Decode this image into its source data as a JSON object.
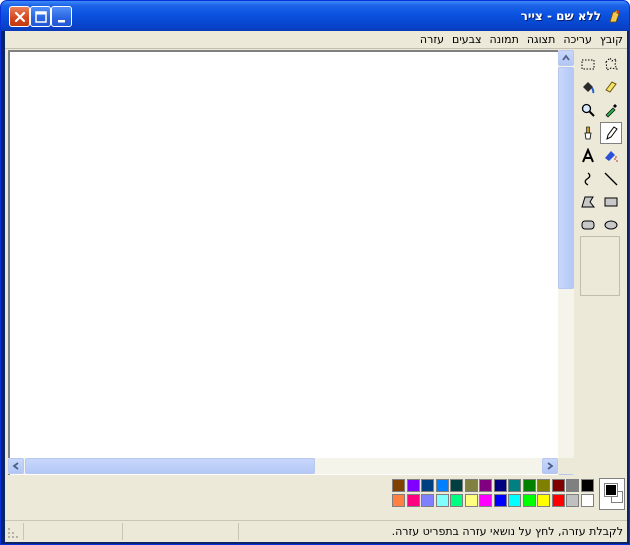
{
  "window": {
    "title": "ללא שם - צייר"
  },
  "menu": [
    "קובץ",
    "עריכה",
    "תצוגה",
    "תמונה",
    "צבעים",
    "עזרה"
  ],
  "tools": [
    "free-form-select-icon",
    "select-icon",
    "eraser-icon",
    "fill-icon",
    "color-picker-icon",
    "magnifier-icon",
    "pencil-icon",
    "brush-icon",
    "airbrush-icon",
    "text-icon",
    "line-icon",
    "curve-icon",
    "rectangle-icon",
    "polygon-icon",
    "ellipse-icon",
    "rounded-rectangle-icon"
  ],
  "selected_tool": "pencil-icon",
  "colors": {
    "foreground": "#000000",
    "background": "#ffffff",
    "palette_top": [
      "#000000",
      "#808080",
      "#800000",
      "#808000",
      "#008000",
      "#008080",
      "#000080",
      "#800080",
      "#808040",
      "#004040",
      "#0080ff",
      "#004080",
      "#8000ff",
      "#804000"
    ],
    "palette_bottom": [
      "#ffffff",
      "#c0c0c0",
      "#ff0000",
      "#ffff00",
      "#00ff00",
      "#00ffff",
      "#0000ff",
      "#ff00ff",
      "#ffff80",
      "#00ff80",
      "#80ffff",
      "#8080ff",
      "#ff0080",
      "#ff8040"
    ]
  },
  "status": {
    "help_text": "לקבלת עזרה, לחץ על נושאי עזרה בתפריט עזרה."
  }
}
